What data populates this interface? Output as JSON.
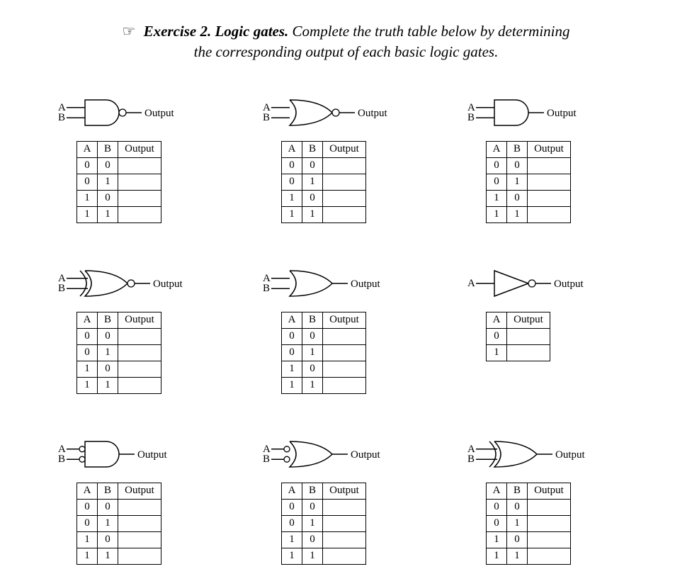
{
  "header": {
    "hand": "☞",
    "title": "Exercise 2. Logic gates.",
    "instruction_part1": "Complete the truth table below by determining",
    "instruction_part2": "the corresponding output of each basic logic gates."
  },
  "labels": {
    "A": "A",
    "B": "B",
    "Output": "Output"
  },
  "gates": [
    {
      "type": "NAND",
      "inputs": 2
    },
    {
      "type": "NOR",
      "inputs": 2
    },
    {
      "type": "AND",
      "inputs": 2
    },
    {
      "type": "XNOR",
      "inputs": 2
    },
    {
      "type": "OR",
      "inputs": 2
    },
    {
      "type": "NOT",
      "inputs": 1
    },
    {
      "type": "AND_NEGIN",
      "inputs": 2
    },
    {
      "type": "OR_NEGIN",
      "inputs": 2
    },
    {
      "type": "XOR",
      "inputs": 2
    }
  ],
  "truth_rows_2": [
    {
      "A": "0",
      "B": "0",
      "Out": ""
    },
    {
      "A": "0",
      "B": "1",
      "Out": ""
    },
    {
      "A": "1",
      "B": "0",
      "Out": ""
    },
    {
      "A": "1",
      "B": "1",
      "Out": ""
    }
  ],
  "truth_rows_1": [
    {
      "A": "0",
      "Out": ""
    },
    {
      "A": "1",
      "Out": ""
    }
  ],
  "chart_data": {
    "type": "table",
    "description": "Nine logic gate truth tables with blank output columns to be filled in",
    "gates": [
      {
        "name": "NAND",
        "inputs": [
          "A",
          "B"
        ],
        "rows": [
          [
            "0",
            "0",
            ""
          ],
          [
            "0",
            "1",
            ""
          ],
          [
            "1",
            "0",
            ""
          ],
          [
            "1",
            "1",
            ""
          ]
        ]
      },
      {
        "name": "NOR",
        "inputs": [
          "A",
          "B"
        ],
        "rows": [
          [
            "0",
            "0",
            ""
          ],
          [
            "0",
            "1",
            ""
          ],
          [
            "1",
            "0",
            ""
          ],
          [
            "1",
            "1",
            ""
          ]
        ]
      },
      {
        "name": "AND",
        "inputs": [
          "A",
          "B"
        ],
        "rows": [
          [
            "0",
            "0",
            ""
          ],
          [
            "0",
            "1",
            ""
          ],
          [
            "1",
            "0",
            ""
          ],
          [
            "1",
            "1",
            ""
          ]
        ]
      },
      {
        "name": "XNOR",
        "inputs": [
          "A",
          "B"
        ],
        "rows": [
          [
            "0",
            "0",
            ""
          ],
          [
            "0",
            "1",
            ""
          ],
          [
            "1",
            "0",
            ""
          ],
          [
            "1",
            "1",
            ""
          ]
        ]
      },
      {
        "name": "OR",
        "inputs": [
          "A",
          "B"
        ],
        "rows": [
          [
            "0",
            "0",
            ""
          ],
          [
            "0",
            "1",
            ""
          ],
          [
            "1",
            "0",
            ""
          ],
          [
            "1",
            "1",
            ""
          ]
        ]
      },
      {
        "name": "NOT",
        "inputs": [
          "A"
        ],
        "rows": [
          [
            "0",
            ""
          ],
          [
            "1",
            ""
          ]
        ]
      },
      {
        "name": "AND with negated inputs",
        "inputs": [
          "A",
          "B"
        ],
        "rows": [
          [
            "0",
            "0",
            ""
          ],
          [
            "0",
            "1",
            ""
          ],
          [
            "1",
            "0",
            ""
          ],
          [
            "1",
            "1",
            ""
          ]
        ]
      },
      {
        "name": "OR with negated inputs",
        "inputs": [
          "A",
          "B"
        ],
        "rows": [
          [
            "0",
            "0",
            ""
          ],
          [
            "0",
            "1",
            ""
          ],
          [
            "1",
            "0",
            ""
          ],
          [
            "1",
            "1",
            ""
          ]
        ]
      },
      {
        "name": "XOR",
        "inputs": [
          "A",
          "B"
        ],
        "rows": [
          [
            "0",
            "0",
            ""
          ],
          [
            "0",
            "1",
            ""
          ],
          [
            "1",
            "0",
            ""
          ],
          [
            "1",
            "1",
            ""
          ]
        ]
      }
    ]
  }
}
